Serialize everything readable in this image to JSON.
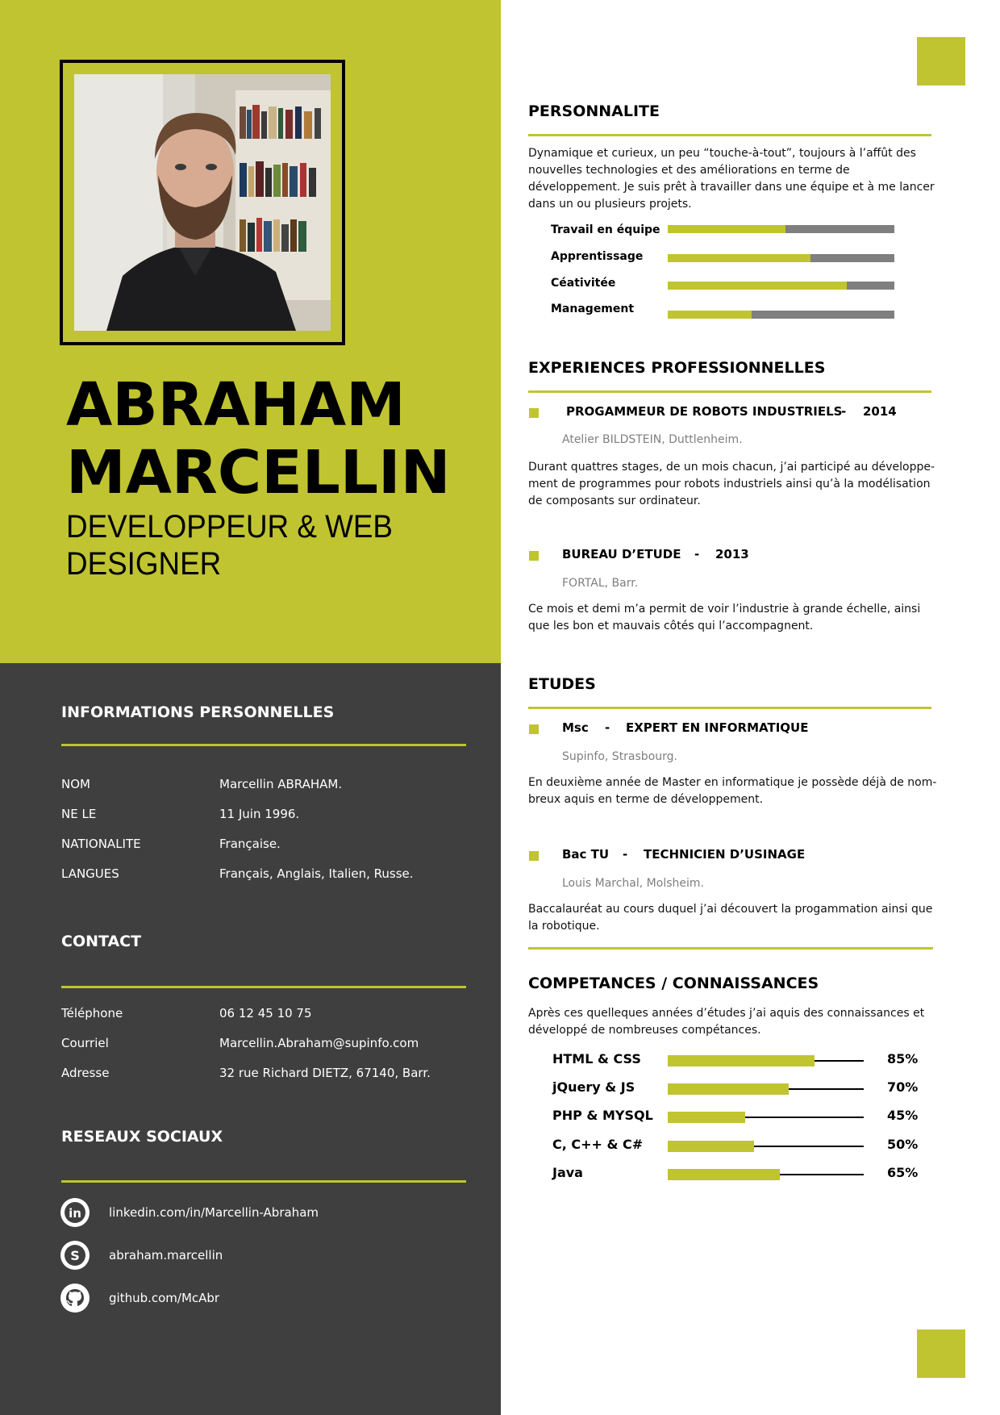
{
  "colors": {
    "accent": "#c0c431",
    "dark": "#3f3f3f",
    "bar_gray": "#7f7f7f"
  },
  "header": {
    "first_line": "ABRAHAM",
    "second_line": "MARCELLIN",
    "title_line1": "DEVELOPPEUR & WEB",
    "title_line2": "DESIGNER"
  },
  "personal": {
    "heading": "INFORMATIONS PERSONNELLES",
    "rows": [
      {
        "label": "NOM",
        "value": "Marcellin ABRAHAM."
      },
      {
        "label": "NE LE",
        "value": "11 Juin 1996."
      },
      {
        "label": "NATIONALITE",
        "value": "Française."
      },
      {
        "label": "LANGUES",
        "value": "Français, Anglais, Italien, Russe."
      }
    ]
  },
  "contact": {
    "heading": "CONTACT",
    "rows": [
      {
        "label": "Téléphone",
        "value": "06 12 45 10 75"
      },
      {
        "label": "Courriel",
        "value": "Marcellin.Abraham@supinfo.com"
      },
      {
        "label": "Adresse",
        "value": "32 rue Richard DIETZ, 67140, Barr."
      }
    ]
  },
  "social": {
    "heading": "RESEAUX SOCIAUX",
    "items": [
      {
        "icon": "linkedin-icon",
        "text": "linkedin.com/in/Marcellin-Abraham"
      },
      {
        "icon": "skype-icon",
        "text": "abraham.marcellin"
      },
      {
        "icon": "github-icon",
        "text": "github.com/McAbr"
      }
    ]
  },
  "personality": {
    "heading": "PERSONNALITE",
    "text": "Dynamique et curieux, un peu “touche-à-tout”, toujours à l’affût des nouvelles technologies et des améliorations en terme de développement. Je suis prêt à travailler dans une équipe et à me lancer dans un ou plusieurs projets.",
    "skills": [
      {
        "label": "Travail en équipe",
        "level": 0.52
      },
      {
        "label": "Apprentissage",
        "level": 0.63
      },
      {
        "label": "Céativitée",
        "level": 0.79
      },
      {
        "label": "Management",
        "level": 0.37
      }
    ]
  },
  "experience": {
    "heading": "EXPERIENCES PROFESSIONNELLES",
    "items": [
      {
        "title": "PROGAMMEUR DE ROBOTS INDUSTRIELS",
        "sep": "-",
        "year": "2014",
        "place": "Atelier BILDSTEIN, Duttlenheim.",
        "text": "Durant quattres stages, de un mois chacun, j’ai participé au développe-ment de programmes pour robots industriels ainsi qu’à la modélisation de composants sur ordinateur."
      },
      {
        "title": "BUREAU D’ETUDE",
        "sep": "-",
        "year": "2013",
        "place": "FORTAL, Barr.",
        "text": "Ce mois et demi m’a permit de voir l’industrie à grande échelle, ainsi que les bon et mauvais côtés qui l’accompagnent."
      }
    ]
  },
  "studies": {
    "heading": "ETUDES",
    "items": [
      {
        "degree": "Msc",
        "sep": "-",
        "title": "EXPERT EN INFORMATIQUE",
        "place": "Supinfo, Strasbourg.",
        "text": "En deuxième année de Master en informatique je possède déjà de nom-breux aquis en terme de développement."
      },
      {
        "degree": "Bac TU",
        "sep": "-",
        "title": "TECHNICIEN D’USINAGE",
        "place": "Louis Marchal, Molsheim.",
        "text": "Baccalauréat au cours duquel j’ai découvert la progammation ainsi que la robotique."
      }
    ]
  },
  "competences": {
    "heading": "COMPETANCES / CONNAISSANCES",
    "text": "Après ces quelleques années d’études j’ai aquis des connaissances et développé de nombreuses compétances.",
    "items": [
      {
        "label": "HTML & CSS",
        "percent": 85,
        "percent_label": "85%"
      },
      {
        "label": "jQuery & JS",
        "percent": 70,
        "percent_label": "70%"
      },
      {
        "label": "PHP & MYSQL",
        "percent": 45,
        "percent_label": "45%"
      },
      {
        "label": "C, C++ & C#",
        "percent": 50,
        "percent_label": "50%"
      },
      {
        "label": "Java",
        "percent": 65,
        "percent_label": "65%"
      }
    ]
  }
}
